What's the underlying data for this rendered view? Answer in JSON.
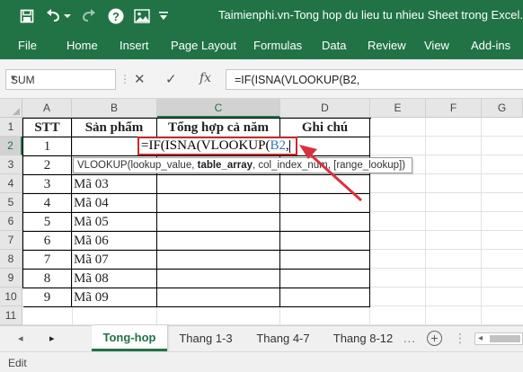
{
  "window": {
    "title": "Taimienphi.vn-Tong hop du lieu tu nhieu Sheet trong Excel.xls",
    "brand_color": "#217346"
  },
  "quick_access": {
    "icons": [
      "save-icon",
      "undo-icon",
      "undo-dropdown-icon",
      "help-icon",
      "image-icon",
      "dropdown-icon"
    ]
  },
  "ribbon": {
    "tabs": [
      "File",
      "Home",
      "Insert",
      "Page Layout",
      "Formulas",
      "Data",
      "Review",
      "View",
      "Add-ins"
    ]
  },
  "formula_bar": {
    "name_box": "SUM",
    "cancel_symbol": "✕",
    "enter_symbol": "✓",
    "fx": "fx",
    "formula": "=IF(ISNA(VLOOKUP(B2,"
  },
  "grid": {
    "columns": [
      "A",
      "B",
      "C",
      "D",
      "E",
      "F",
      "G"
    ],
    "rows": [
      "1",
      "2",
      "3",
      "4",
      "5",
      "6",
      "7",
      "8",
      "9",
      "10",
      "11"
    ],
    "active_column": "C",
    "active_row": "2"
  },
  "table": {
    "headers": [
      "STT",
      "Sản phẩm",
      "Tổng hợp cả năm",
      "Ghi chú"
    ],
    "rows": [
      [
        "1",
        "",
        "",
        ""
      ],
      [
        "2",
        "Mã 02",
        "",
        ""
      ],
      [
        "3",
        "Mã 03",
        "",
        ""
      ],
      [
        "4",
        "Mã 04",
        "",
        ""
      ],
      [
        "5",
        "Mã 05",
        "",
        ""
      ],
      [
        "6",
        "Mã 06",
        "",
        ""
      ],
      [
        "7",
        "Mã 07",
        "",
        ""
      ],
      [
        "8",
        "Mã 08",
        "",
        ""
      ],
      [
        "9",
        "Mã 09",
        "",
        ""
      ]
    ]
  },
  "editor": {
    "prefix": "=IF(ISNA(VLOOKUP(",
    "ref": "B2",
    "suffix": ","
  },
  "tooltip": {
    "fn": "VLOOKUP(",
    "arg1": "lookup_value, ",
    "arg2": "table_array",
    "rest": ", col_index_num, [range_lookup])"
  },
  "annotation": {
    "arrow_color": "#d9303e"
  },
  "sheets": {
    "tabs": [
      "Tong-hop",
      "Thang 1-3",
      "Thang 4-7",
      "Thang 8-12"
    ],
    "active": "Tong-hop",
    "more": "...",
    "add": "+"
  },
  "status": {
    "mode": "Edit"
  }
}
